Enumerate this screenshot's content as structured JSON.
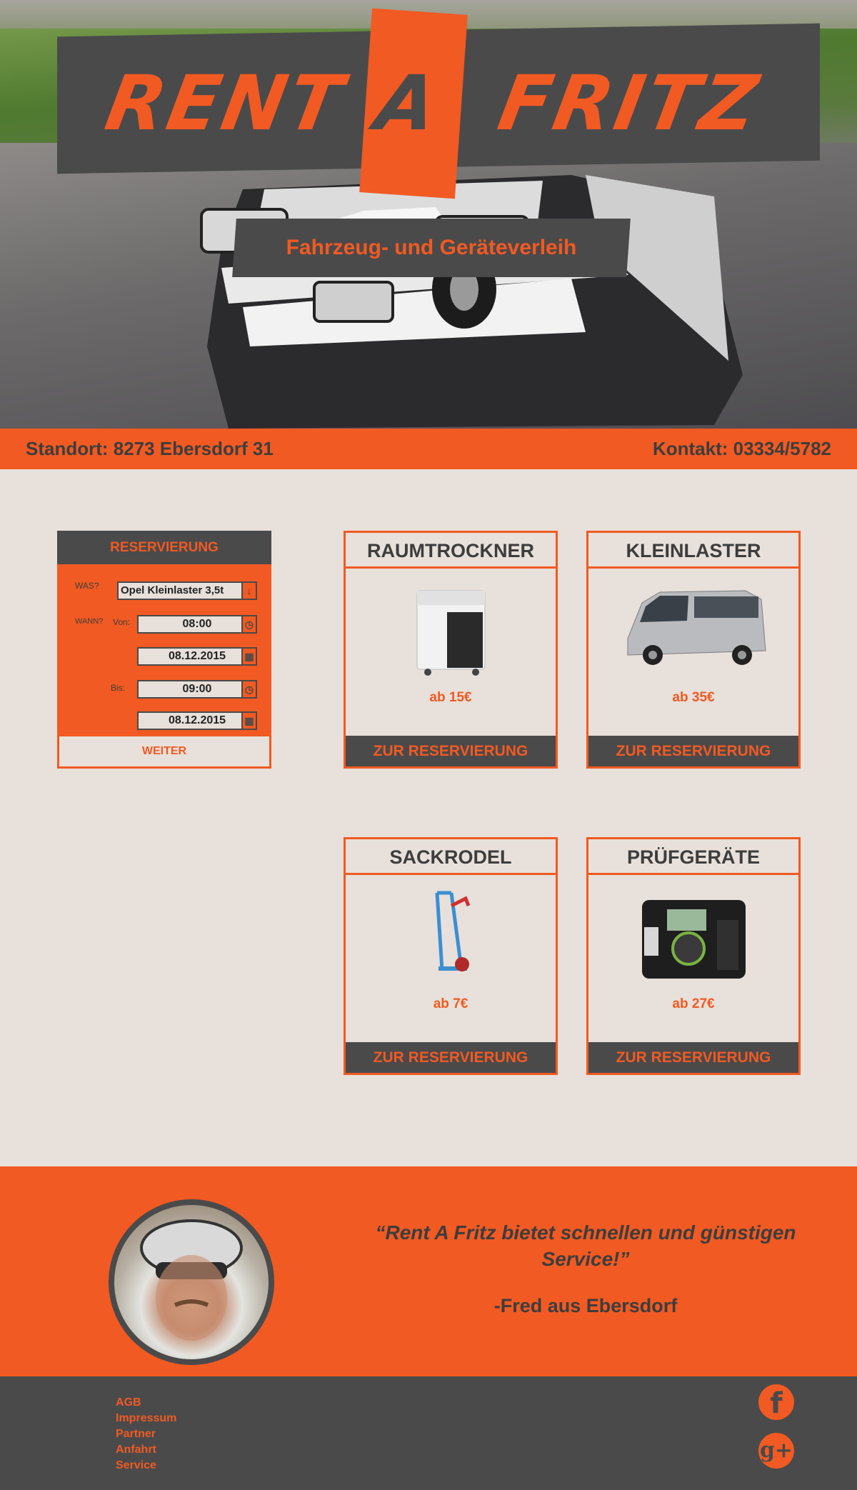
{
  "brand": {
    "logo_rent": "RENT",
    "logo_a": "A",
    "logo_fritz": "FRITZ",
    "tagline": "Fahrzeug- und Geräteverleih"
  },
  "infobar": {
    "location": "Standort: 8273 Ebersdorf 31",
    "contact": "Kontakt: 03334/5782"
  },
  "reservation": {
    "title": "RESERVIERUNG",
    "what_label": "WAS?",
    "what_value": "Opel  Kleinlaster 3,5t",
    "when_label": "WANN?",
    "from_label": "Von:",
    "from_time": "08:00",
    "from_date": "08.12.2015",
    "to_label": "Bis:",
    "to_time": "09:00",
    "to_date": "08.12.2015",
    "submit": "WEITER"
  },
  "products": [
    {
      "title": "RAUMTROCKNER",
      "price": "ab 15€",
      "button": "ZUR RESERVIERUNG",
      "icon": "dehumidifier-image"
    },
    {
      "title": "KLEINLASTER",
      "price": "ab 35€",
      "button": "ZUR RESERVIERUNG",
      "icon": "van-image"
    },
    {
      "title": "SACKRODEL",
      "price": "ab 7€",
      "button": "ZUR RESERVIERUNG",
      "icon": "hand-truck-image"
    },
    {
      "title": "PRÜFGERÄTE",
      "price": "ab 27€",
      "button": "ZUR RESERVIERUNG",
      "icon": "tester-image"
    }
  ],
  "testimonial": {
    "quote": "“Rent A Fritz bietet schnellen und günstigen Service!”",
    "author": "-Fred aus Ebersdorf"
  },
  "footer": {
    "links": [
      "AGB",
      "Impressum",
      "Partner",
      "Anfahrt",
      "Service"
    ],
    "facebook": "f",
    "googleplus": "g+"
  },
  "colors": {
    "accent": "#f15a22",
    "dark": "#4a4a4b",
    "background": "#e8e0da"
  }
}
